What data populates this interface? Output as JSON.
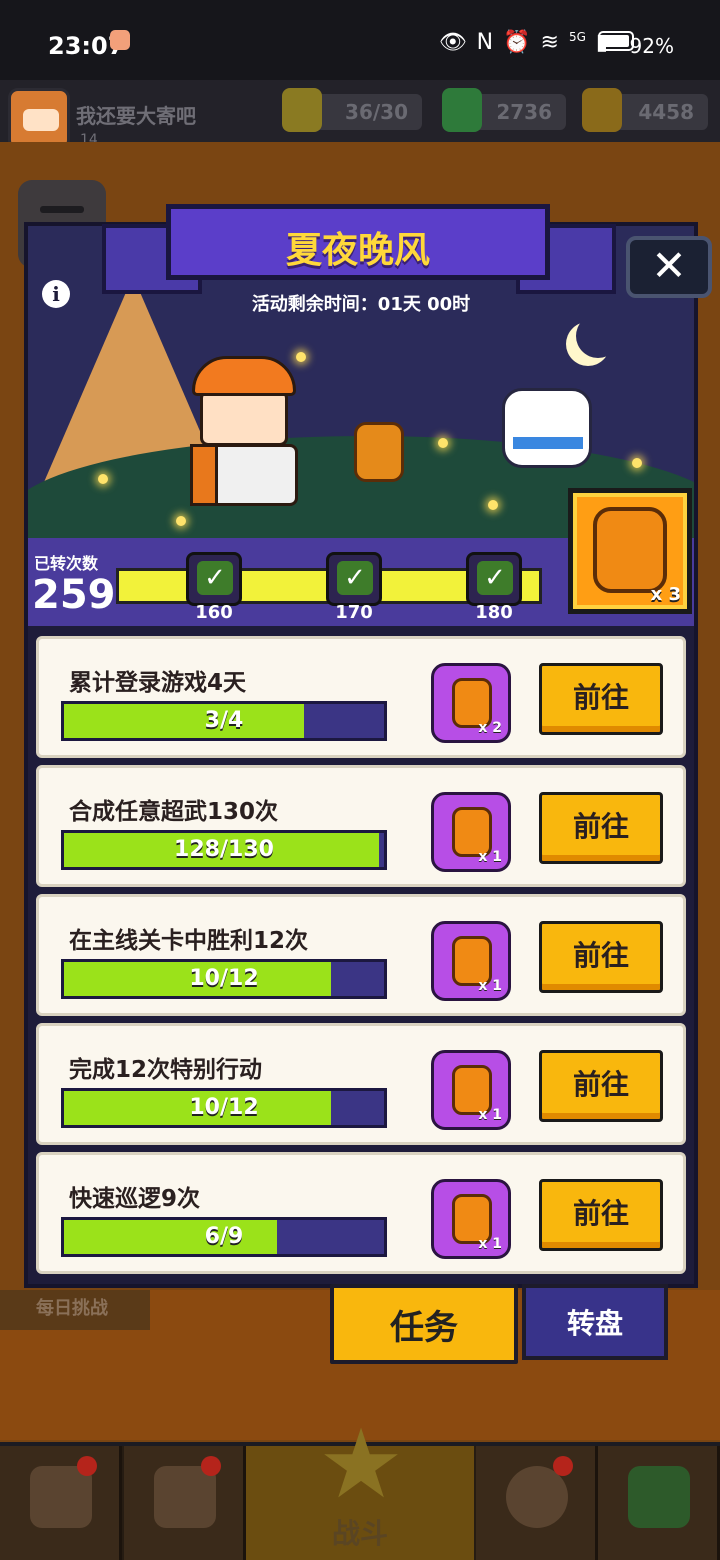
{
  "status_bar": {
    "time": "23:07",
    "network": "5G",
    "battery": "92%"
  },
  "player": {
    "name": "我还要大寄吧",
    "level": "14"
  },
  "resources": {
    "energy": "36/30",
    "gems": "2736",
    "coins": "4458"
  },
  "event": {
    "title": "夏夜晚风",
    "timer": "活动剩余时间：01天 00时",
    "turns_label": "已转次数",
    "turns_count": "259",
    "milestones": [
      {
        "value": "160",
        "claimed": true
      },
      {
        "value": "170",
        "claimed": true
      },
      {
        "value": "180",
        "claimed": true
      }
    ],
    "big_reward_qty": "x 3"
  },
  "tasks": [
    {
      "title": "累计登录游戏4天",
      "progress": "3/4",
      "fraction": 0.75,
      "reward_qty": "x 2",
      "button": "前往"
    },
    {
      "title": "合成任意超武130次",
      "progress": "128/130",
      "fraction": 0.985,
      "reward_qty": "x 1",
      "button": "前往"
    },
    {
      "title": "在主线关卡中胜利12次",
      "progress": "10/12",
      "fraction": 0.833,
      "reward_qty": "x 1",
      "button": "前往"
    },
    {
      "title": "完成12次特别行动",
      "progress": "10/12",
      "fraction": 0.833,
      "reward_qty": "x 1",
      "button": "前往"
    },
    {
      "title": "快速巡逻9次",
      "progress": "6/9",
      "fraction": 0.667,
      "reward_qty": "x 1",
      "button": "前往"
    }
  ],
  "tabs": {
    "daily": "每日挑战",
    "task": "任务",
    "wheel": "转盘"
  },
  "nav": {
    "battle": "战斗"
  },
  "colors": {
    "accent_yellow": "#f9b70d",
    "progress_green": "#9be21a",
    "banner_purple": "#5b3ec9"
  }
}
